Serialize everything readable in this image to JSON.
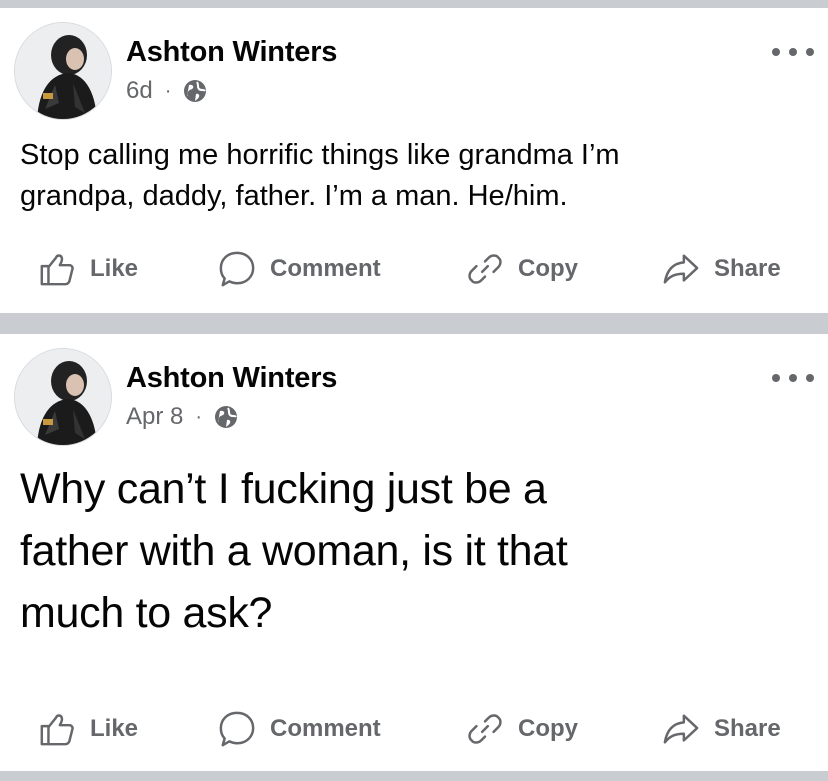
{
  "posts": [
    {
      "author": "Ashton Winters",
      "time": "6d",
      "separator": "·",
      "text_lines": [
        "Stop calling me horrific things like grandma I’m",
        "grandpa, daddy, father.  I’m a man.  He/him."
      ],
      "actions": {
        "like": "Like",
        "comment": "Comment",
        "copy": "Copy",
        "share": "Share"
      }
    },
    {
      "author": "Ashton Winters",
      "time": "Apr 8",
      "separator": "·",
      "text_lines": [
        "Why can’t I fucking just be a",
        "father with a woman, is it that",
        "much to ask?"
      ],
      "actions": {
        "like": "Like",
        "comment": "Comment",
        "copy": "Copy",
        "share": "Share"
      }
    }
  ],
  "icons": {
    "like": "thumbs-up-icon",
    "comment": "comment-bubble-icon",
    "copy": "link-icon",
    "share": "share-arrow-icon",
    "privacy": "globe-icon",
    "more": "more-dots-icon"
  },
  "colors": {
    "text": "#050505",
    "secondary": "#65676b",
    "divider": "#c9ccd1"
  }
}
